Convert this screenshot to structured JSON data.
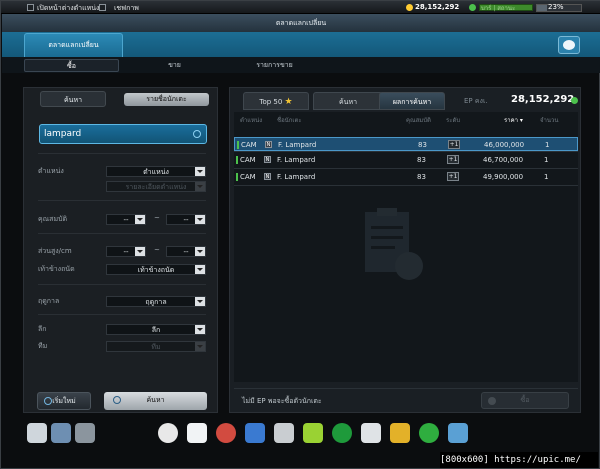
{
  "topbar": {
    "link1": "เปิดหน้าต่างตำแหน่ง",
    "link2": "เชฟกาพ",
    "money": "28,152,292",
    "energy_text": "บาร์ | สถานะ",
    "percent": "23%",
    "percent_value": 0.23
  },
  "window_title": "ตลาดแลกเปลี่ยน",
  "header": {
    "tab": "ตลาดแลกเปลี่ยน"
  },
  "subnav": {
    "buy": "ซื้อ",
    "sell": "ขาย",
    "list": "รายการขาย"
  },
  "left": {
    "tab_search": "ค้นหา",
    "tab_name": "รายชื่อนักเตะ",
    "search_value": "lampard",
    "position_label": "ตำแหน่ง",
    "position_value": "ตำแหน่ง",
    "position_detail": "รายละเอียดตำแหน่ง",
    "ability_label": "คุณสมบัติ",
    "ability_from": "--",
    "ability_to": "--",
    "dash": "~",
    "height_label": "ส่วนสูง/cm",
    "height_from": "--",
    "height_to": "--",
    "foot_label": "เท้าข้างถนัด",
    "foot_value": "เท้าข้างถนัด",
    "season_label": "ฤดูกาล",
    "season_value": "ฤดูกาล",
    "league_label": "ลีก",
    "league_value": "ลีก",
    "team_label": "ทีม",
    "team_value": "ทีม",
    "reset": "เริ่มใหม่",
    "search_btn": "ค้นหา"
  },
  "right": {
    "tab_top50": "Top 50",
    "tab_search": "ค้นหา",
    "tab_result": "ผลการค้นหา",
    "ep_label": "EP คงเ.",
    "ep_value": "28,152,292",
    "columns": [
      "ตำแหน่ง",
      "ชื่อนักเตะ",
      "คุณสมบัติ",
      "ระดับ",
      "ราคา ▾",
      "จำนวน"
    ],
    "rows": [
      {
        "pos": "CAM",
        "flag": "N",
        "name": "F. Lampard",
        "ovr": "83",
        "lvl": "+1",
        "price": "46,000,000",
        "qty": "1"
      },
      {
        "pos": "CAM",
        "flag": "N",
        "name": "F. Lampard",
        "ovr": "83",
        "lvl": "+1",
        "price": "46,700,000",
        "qty": "1"
      },
      {
        "pos": "CAM",
        "flag": "N",
        "name": "F. Lampard",
        "ovr": "83",
        "lvl": "+1",
        "price": "49,900,000",
        "qty": "1"
      }
    ],
    "footer_msg": "ไม่มี EP พอจะซื้อตัวนักเตะ",
    "buy_btn": "ซื้อ"
  },
  "dock_icons": [
    "settings-icon",
    "inventory-icon",
    "mail-icon",
    "boots-icon",
    "shoe-icon",
    "ball-icon",
    "wing-icon",
    "trophy-icon",
    "triangle-icon",
    "badge-2000-icon",
    "card-icon",
    "gold-icon",
    "club-icon",
    "cart-icon"
  ],
  "credit": "[800x600] https://upic.me/"
}
